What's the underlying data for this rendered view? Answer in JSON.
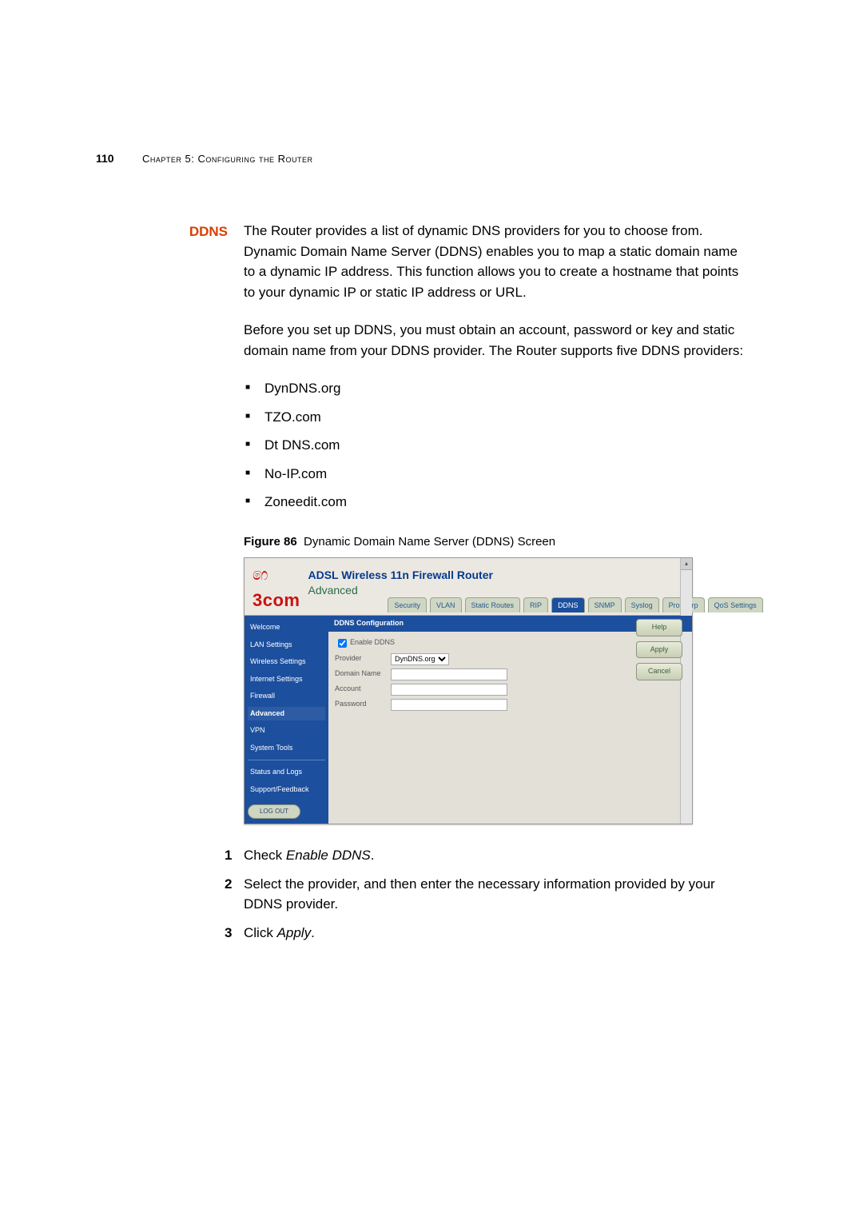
{
  "page_number": "110",
  "chapter_header": "Chapter 5: Configuring the Router",
  "section_label": "DDNS",
  "para1": "The Router provides a list of dynamic DNS providers for you to choose from. Dynamic Domain Name Server (DDNS) enables you to map a static domain name to a dynamic IP address. This function allows you to create a hostname that points to your dynamic IP or static IP address or URL.",
  "para2": "Before you set up DDNS, you must obtain an account, password or key and static domain name from your DDNS provider. The Router supports five DDNS providers:",
  "providers": [
    "DynDNS.org",
    "TZO.com",
    "Dt DNS.com",
    "No-IP.com",
    "Zoneedit.com"
  ],
  "figure_num": "Figure 86",
  "figure_title": "Dynamic Domain Name Server (DDNS) Screen",
  "shot": {
    "logo": "3com",
    "device_title": "ADSL Wireless 11n Firewall Router",
    "breadcrumb": "Advanced",
    "tabs": [
      "Security",
      "VLAN",
      "Static Routes",
      "RIP",
      "DDNS",
      "SNMP",
      "Syslog",
      "ProxyArp",
      "QoS Settings"
    ],
    "active_tab": "DDNS",
    "sidebar": [
      "Welcome",
      "LAN Settings",
      "Wireless Settings",
      "Internet Settings",
      "Firewall",
      "Advanced",
      "VPN",
      "System Tools",
      "Status and Logs",
      "Support/Feedback"
    ],
    "active_sidebar": "Advanced",
    "logout": "LOG OUT",
    "panel_title": "DDNS Configuration",
    "enable_label": "Enable DDNS",
    "enable_checked": true,
    "fields": {
      "provider_label": "Provider",
      "provider_value": "DynDNS.org",
      "domain_label": "Domain Name",
      "account_label": "Account",
      "password_label": "Password"
    },
    "buttons": {
      "help": "Help",
      "apply": "Apply",
      "cancel": "Cancel"
    }
  },
  "steps": {
    "s1a": "Check ",
    "s1b": "Enable DDNS",
    "s1c": ".",
    "s2": "Select the provider, and then enter the necessary information provided by your DDNS provider.",
    "s3a": "Click ",
    "s3b": "Apply",
    "s3c": "."
  }
}
